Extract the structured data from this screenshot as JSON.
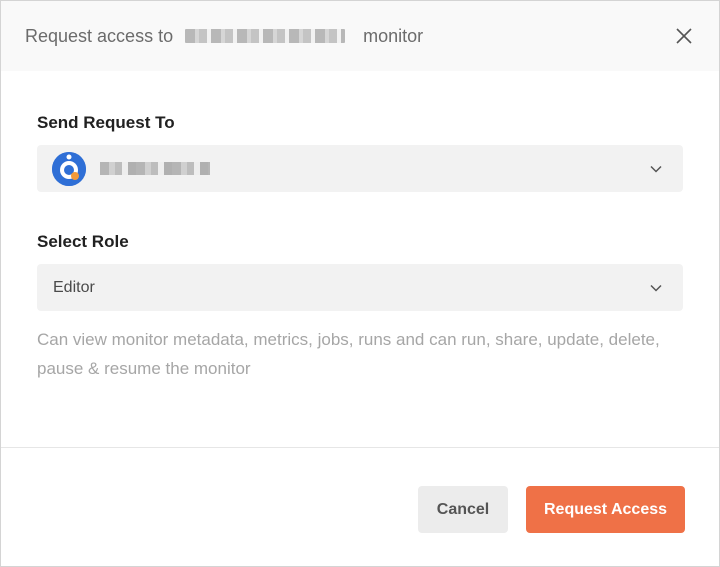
{
  "header": {
    "title_prefix": "Request access to",
    "title_suffix": "monitor"
  },
  "send_request": {
    "label": "Send Request To"
  },
  "role": {
    "label": "Select Role",
    "selected": "Editor",
    "description": "Can view monitor metadata, metrics, jobs, runs and can run, share, update, delete, pause & resume the monitor"
  },
  "footer": {
    "cancel_label": "Cancel",
    "submit_label": "Request Access"
  },
  "icons": {
    "close": "close-icon",
    "chevron": "chevron-down-icon",
    "avatar": "team-avatar-icon"
  },
  "colors": {
    "accent": "#ef7147",
    "avatar_bg": "#2f6fd6"
  }
}
